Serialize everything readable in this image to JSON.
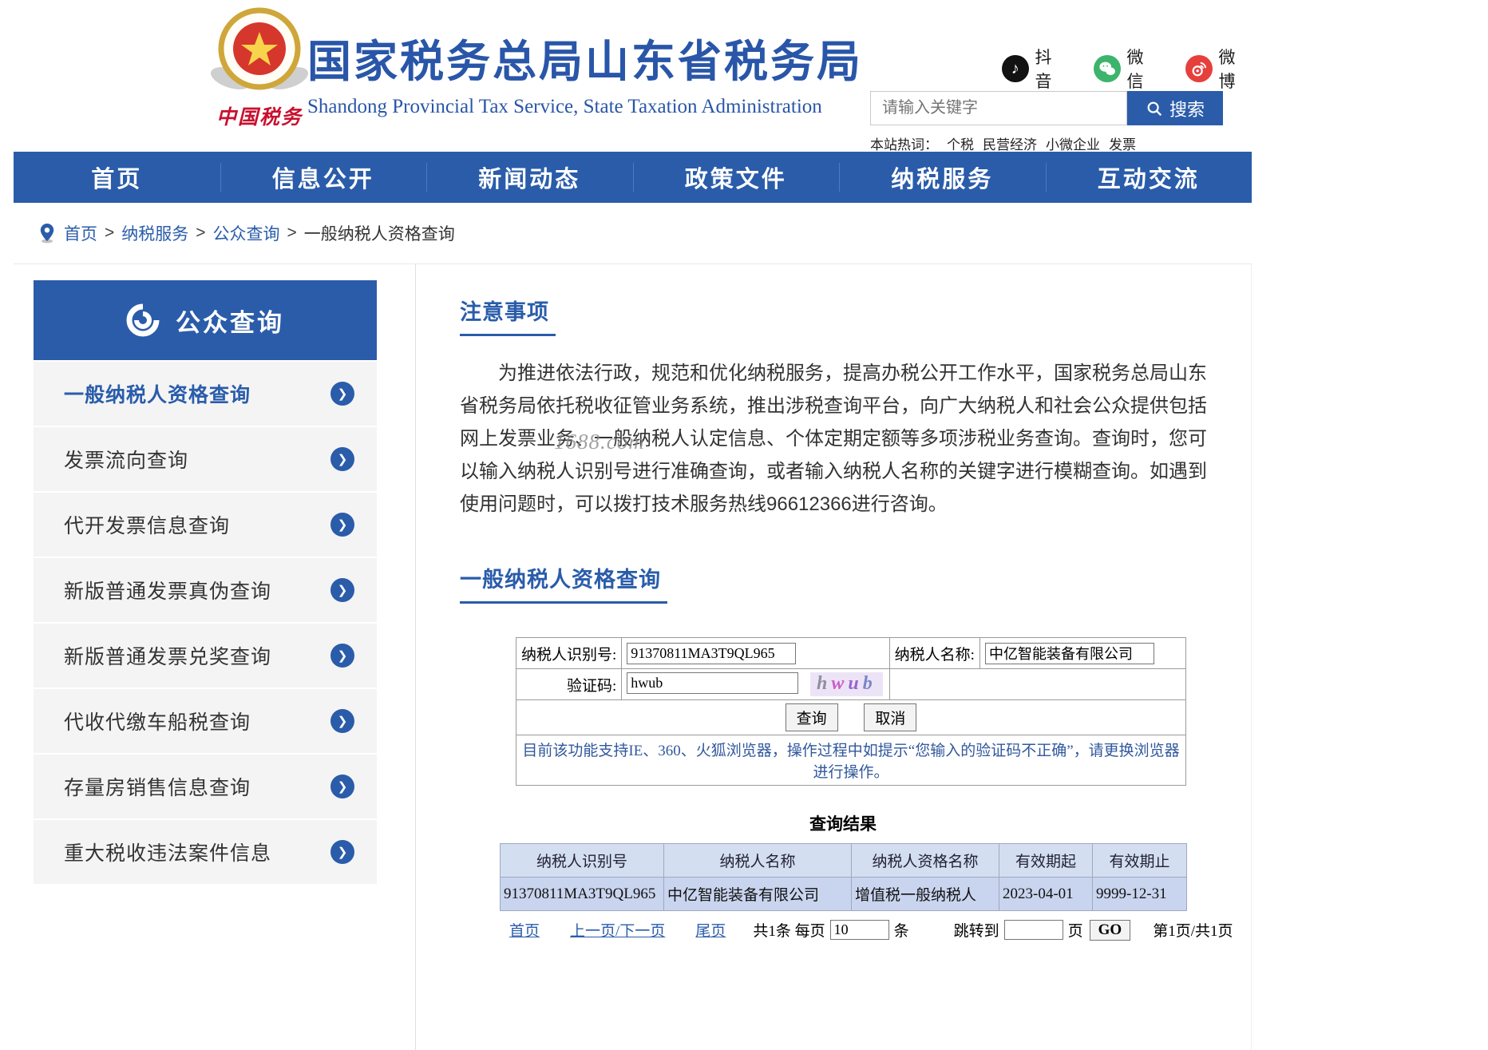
{
  "colors": {
    "accent": "#2a5caa",
    "nav_bg": "#2a5caa",
    "result_header_bg": "#d4def1",
    "result_row_bg": "#c9d4ee"
  },
  "header": {
    "logo_label": "中国税务",
    "site_title": "国家税务总局山东省税务局",
    "site_subtitle": "Shandong Provincial Tax Service, State Taxation Administration",
    "social": [
      {
        "name": "douyin",
        "label": "抖音"
      },
      {
        "name": "wechat",
        "label": "微信"
      },
      {
        "name": "weibo",
        "label": "微博"
      }
    ],
    "search": {
      "placeholder": "请输入关键字",
      "button_label": "搜索"
    },
    "hot_words_label": "本站热词：",
    "hot_words": [
      "个税",
      "民营经济",
      "小微企业",
      "发票"
    ]
  },
  "nav": {
    "items": [
      "首页",
      "信息公开",
      "新闻动态",
      "政策文件",
      "纳税服务",
      "互动交流"
    ]
  },
  "breadcrumb": {
    "separator": ">",
    "items": [
      "首页",
      "纳税服务",
      "公众查询",
      "一般纳税人资格查询"
    ]
  },
  "sidebar": {
    "title": "公众查询",
    "items": [
      {
        "label": "一般纳税人资格查询",
        "active": true
      },
      {
        "label": "发票流向查询",
        "active": false
      },
      {
        "label": "代开发票信息查询",
        "active": false
      },
      {
        "label": "新版普通发票真伪查询",
        "active": false
      },
      {
        "label": "新版普通发票兑奖查询",
        "active": false
      },
      {
        "label": "代收代缴车船税查询",
        "active": false
      },
      {
        "label": "存量房销售信息查询",
        "active": false
      },
      {
        "label": "重大税收违法案件信息",
        "active": false
      }
    ]
  },
  "main": {
    "notice": {
      "title": "注意事项",
      "body": "为推进依法行政，规范和优化纳税服务，提高办税公开工作水平，国家税务总局山东省税务局依托税收征管业务系统，推出涉税查询平台，向广大纳税人和社会公众提供包括网上发票业务、一般纳税人认定信息、个体定期定额等多项涉税业务查询。查询时，您可以输入纳税人识别号进行准确查询，或者输入纳税人名称的关键字进行模糊查询。如遇到使用问题时，可以拨打技术服务热线96612366进行咨询。"
    },
    "watermark": "1688.com",
    "query": {
      "title": "一般纳税人资格查询",
      "form": {
        "taxpayer_id_label": "纳税人识别号:",
        "taxpayer_id_value": "91370811MA3T9QL965",
        "taxpayer_name_label": "纳税人名称:",
        "taxpayer_name_value": "中亿智能装备有限公司",
        "captcha_label": "验证码:",
        "captcha_value": "hwub",
        "captcha_chars": [
          "h",
          "w",
          "u",
          "b"
        ],
        "submit_label": "查询",
        "cancel_label": "取消",
        "browser_notice": "目前该功能支持IE、360、火狐浏览器，操作过程中如提示“您输入的验证码不正确”，请更换浏览器进行操作。"
      },
      "results": {
        "title": "查询结果",
        "columns": [
          "纳税人识别号",
          "纳税人名称",
          "纳税人资格名称",
          "有效期起",
          "有效期止"
        ],
        "rows": [
          [
            "91370811MA3T9QL965",
            "中亿智能装备有限公司",
            "增值税一般纳税人",
            "2023-04-01",
            "9999-12-31"
          ]
        ],
        "pagination": {
          "first": "首页",
          "prev_next": "上一页/下一页",
          "last": "尾页",
          "total_label": "共1条 每页",
          "per_page_value": "10",
          "per_page_suffix": "条",
          "jump_label": "跳转到",
          "jump_value": "",
          "jump_suffix": "页",
          "go_label": "GO",
          "page_info": "第1页/共1页"
        }
      }
    }
  }
}
